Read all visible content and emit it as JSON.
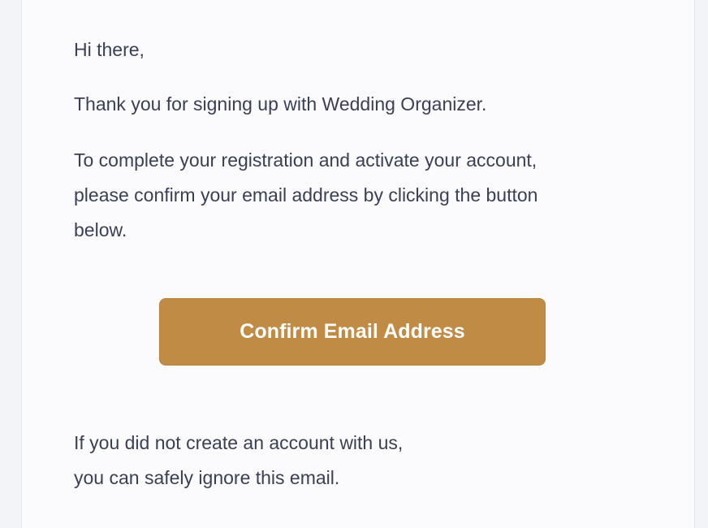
{
  "email": {
    "greeting": "Hi there,",
    "thanks": "Thank you for signing up with Wedding Organizer.",
    "instructions": [
      "To complete your registration and activate your account,",
      "please confirm your email address by clicking the button",
      "below."
    ],
    "confirm_button_label": "Confirm Email Address",
    "footer": [
      "If you did not create an account with us,",
      "you can safely ignore this email."
    ],
    "button_color": "#bf8b45"
  }
}
